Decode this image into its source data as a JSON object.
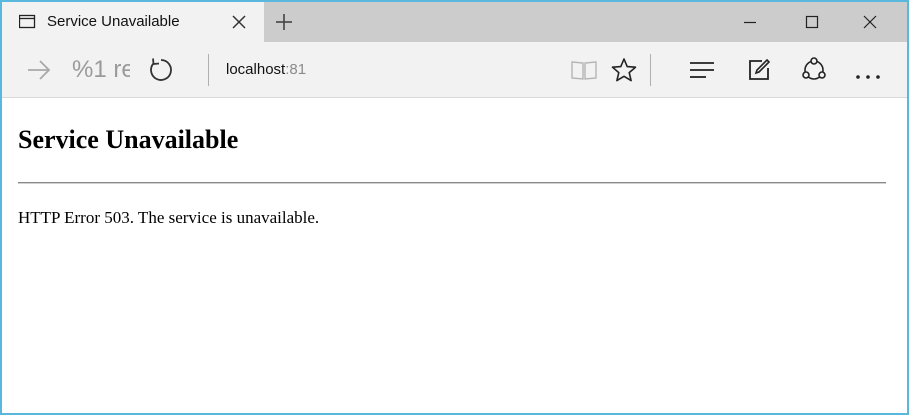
{
  "tab": {
    "title": "Service Unavailable",
    "icon": "page-icon",
    "close_icon": "close-icon",
    "new_tab_icon": "plus-icon"
  },
  "window_controls": {
    "minimize_icon": "minimize-icon",
    "maximize_icon": "maximize-icon",
    "close_icon": "close-icon"
  },
  "toolbar": {
    "forward_icon": "arrow-right-icon",
    "back_ghost_text": "%1 re",
    "refresh_icon": "refresh-icon",
    "address": {
      "host": "localhost",
      "port": ":81"
    },
    "reading_view_icon": "book-icon",
    "favorite_icon": "star-icon",
    "hub_icon": "hub-lines-icon",
    "web_note_icon": "pen-square-icon",
    "share_icon": "share-icon",
    "more_icon": "more-dots-icon"
  },
  "page": {
    "title": "Service Unavailable",
    "message": "HTTP Error 503. The service is unavailable."
  },
  "colors": {
    "window_border": "#5ab8dc",
    "titlebar_bg": "#cccccc",
    "tab_bg": "#f2f2f2",
    "toolbar_bg": "#f2f2f2",
    "page_bg": "#ffffff"
  }
}
